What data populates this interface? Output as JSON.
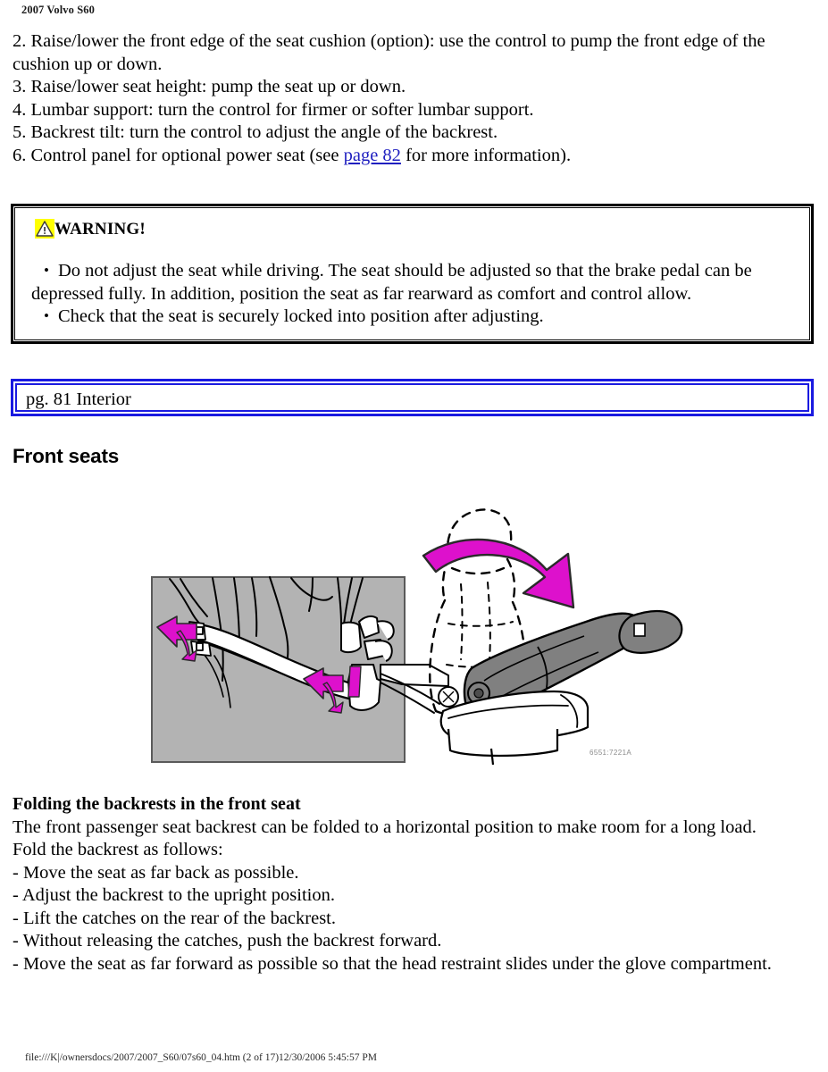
{
  "header": {
    "title": "2007 Volvo S60"
  },
  "instructions": {
    "items": [
      "2. Raise/lower the front edge of the seat cushion (option): use the control to pump the front edge of the cushion up or down.",
      "3. Raise/lower seat height: pump the seat up or down.",
      "4. Lumbar support: turn the control for firmer or softer lumbar support.",
      "5. Backrest tilt: turn the control to adjust the angle of the backrest."
    ],
    "item6_before": "6. Control panel for optional power seat (see ",
    "item6_link": "page 82",
    "item6_after": " for more information)."
  },
  "warning": {
    "icon": "warning-triangle-icon",
    "title": "WARNING!",
    "bullets": [
      "Do not adjust the seat while driving. The seat should be adjusted so that the brake pedal can be depressed fully. In addition, position the seat as far rearward as comfort and control allow.",
      "Check that the seat is securely locked into position after adjusting."
    ],
    "bullet1_line1": "Do not adjust the seat while driving. The seat should be adjusted so that the brake pedal can be",
    "bullet1_line2": "depressed fully. In addition, position the seat as far rearward as comfort and control allow.",
    "border_color": "#000000"
  },
  "page_banner": {
    "text": "pg. 81 Interior",
    "border_color": "#1a1ae0"
  },
  "section": {
    "heading": "Front seats"
  },
  "illustration": {
    "name": "front-seat-folding-illustration",
    "figure_reference": "6551:7221A",
    "arrow_color": "#dd11cc",
    "panel_color": "#b3b3b3",
    "seat_fill": "#808080"
  },
  "folding": {
    "heading": "Folding the backrests in the front seat",
    "intro": "The front passenger seat backrest can be folded to a horizontal position to make room for a long load.",
    "lead_in": "Fold the backrest as follows:",
    "steps": [
      "- Move the seat as far back as possible.",
      "- Adjust the backrest to the upright position.",
      "- Lift the catches on the rear of the backrest.",
      "- Without releasing the catches, push the backrest forward.",
      "- Move the seat as far forward as possible so that the head restraint slides under the glove compartment."
    ]
  },
  "footer": {
    "text": "file:///K|/ownersdocs/2007/2007_S60/07s60_04.htm (2 of 17)12/30/2006 5:45:57 PM"
  }
}
